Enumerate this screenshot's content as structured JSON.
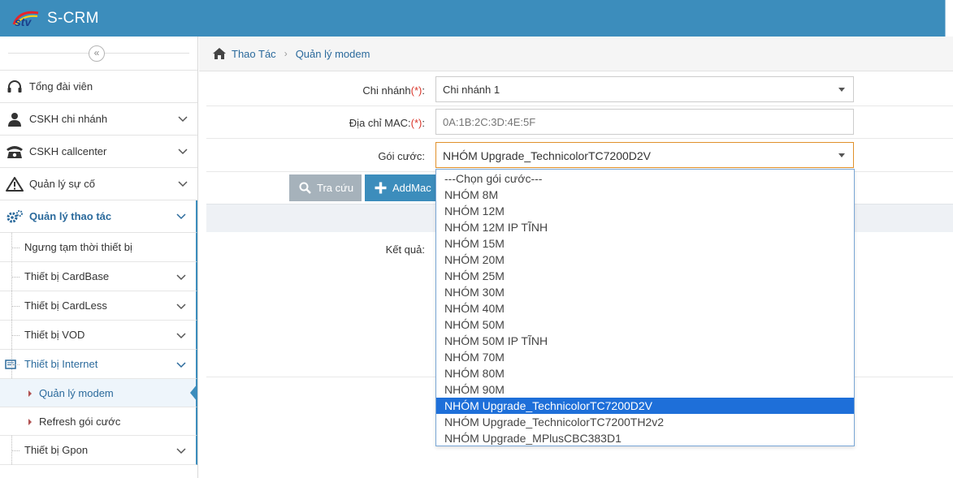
{
  "app": {
    "title": "S-CRM"
  },
  "sidebar": {
    "collapse_glyph": "«",
    "items": [
      {
        "label": "Tổng đài viên",
        "icon": "headset-icon"
      },
      {
        "label": "CSKH chi nhánh",
        "icon": "user-icon"
      },
      {
        "label": "CSKH callcenter",
        "icon": "telephone-icon"
      },
      {
        "label": "Quản lý sự cố",
        "icon": "warning-icon"
      },
      {
        "label": "Quản lý thao tác",
        "icon": "gears-icon"
      }
    ],
    "sub_items": [
      {
        "label": "Ngưng tạm thời thiết bị"
      },
      {
        "label": "Thiết bị CardBase"
      },
      {
        "label": "Thiết bị CardLess"
      },
      {
        "label": "Thiết bị VOD"
      },
      {
        "label": "Thiết bị Internet"
      },
      {
        "label": "Thiết bị Gpon"
      }
    ],
    "internet_children": [
      {
        "label": "Quản lý modem"
      },
      {
        "label": "Refresh gói cước"
      }
    ]
  },
  "breadcrumb": {
    "root": "Thao Tác",
    "current": "Quản lý modem"
  },
  "form": {
    "branch_label": "Chi nhánh",
    "branch_value": "Chi nhánh 1",
    "mac_label": "Địa chỉ MAC:",
    "mac_placeholder": "0A:1B:2C:3D:4E:5F",
    "package_label": "Gói cước:",
    "package_value": "NHÓM Upgrade_TechnicolorTC7200D2V",
    "required_mark": "(*)",
    "colon": ":",
    "search_button": "Tra cứu",
    "add_button": "AddMac",
    "result_label": "Kết quả:"
  },
  "dropdown": {
    "options": [
      "---Chọn gói cước---",
      "NHÓM 8M",
      "NHÓM 12M",
      "NHÓM 12M IP TĨNH",
      "NHÓM 15M",
      "NHÓM 20M",
      "NHÓM 25M",
      "NHÓM 30M",
      "NHÓM 40M",
      "NHÓM 50M",
      "NHÓM 50M IP TĨNH",
      "NHÓM 70M",
      "NHÓM 80M",
      "NHÓM 90M",
      "NHÓM Upgrade_TechnicolorTC7200D2V",
      "NHÓM Upgrade_TechnicolorTC7200TH2v2",
      "NHÓM Upgrade_MPlusCBC383D1"
    ],
    "highlighted_index": 14
  },
  "colors": {
    "header": "#3c8dbc",
    "accent": "#2b6a9c",
    "required": "#d9352a",
    "highlight": "#1e6fd9"
  }
}
